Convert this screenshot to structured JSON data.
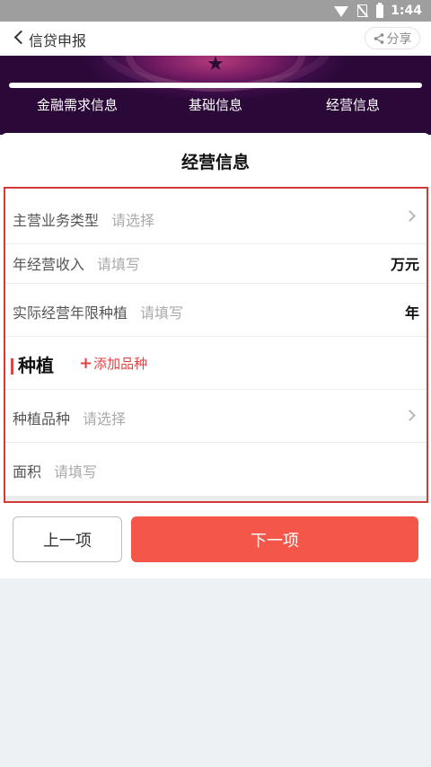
{
  "status_bar": {
    "time": "1:44"
  },
  "nav": {
    "title": "信贷申报",
    "share_label": "分享"
  },
  "steps": [
    "金融需求信息",
    "基础信息",
    "经营信息"
  ],
  "section_title": "经营信息",
  "form": {
    "business_type": {
      "label": "主营业务类型",
      "placeholder": "请选择"
    },
    "annual_income": {
      "label": "年经营收入",
      "placeholder": "请填写",
      "unit": "万元"
    },
    "years": {
      "label": "实际经营年限种植",
      "placeholder": "请填写",
      "unit": "年"
    },
    "planting": {
      "title": "种植",
      "add_label": "添加品种",
      "plus": "+"
    },
    "variety": {
      "label": "种植品种",
      "placeholder": "请选择"
    },
    "area": {
      "label": "面积",
      "placeholder": "请填写"
    }
  },
  "buttons": {
    "prev": "上一项",
    "next": "下一项"
  },
  "colors": {
    "accent": "#f4574a",
    "highlight_border": "#d33a3a",
    "banner": "#4a0f57"
  }
}
